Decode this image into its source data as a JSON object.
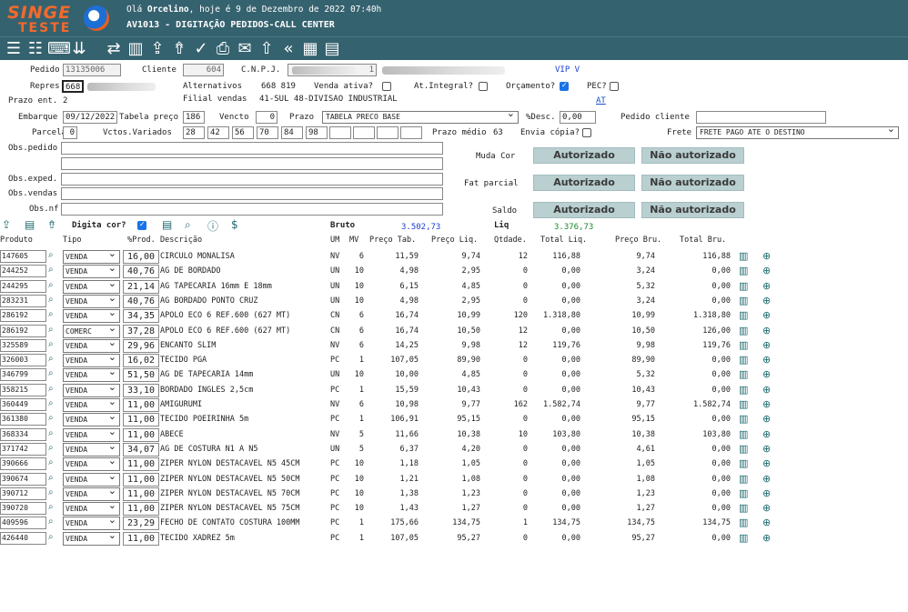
{
  "header": {
    "logo_line1": "SINGE",
    "logo_line2": "TESTE",
    "greeting_prefix": "Olá ",
    "user": "Orcelino",
    "greeting_suffix": ", hoje é 9 de Dezembro de 2022 07:40h",
    "screen_title": "AV1013 - DIGITAÇÃO PEDIDOS-CALL CENTER"
  },
  "toolbar": {
    "icons": [
      "list-icon",
      "checklist-icon",
      "keyboard-list-icon",
      "chevrons-down-icon",
      "refresh-icon",
      "book-icon",
      "upload-tray-icon",
      "upload-person-icon",
      "check-icon",
      "printer-icon",
      "email-icon",
      "upload-icon",
      "double-chevron-left-icon",
      "calculator-icon",
      "clipboard-icon"
    ]
  },
  "form": {
    "pedido_label": "Pedido",
    "pedido_value": "13135006",
    "cliente_label": "Cliente",
    "cliente_value": "604",
    "cnpj_label": "C.N.P.J.",
    "cnpj_suffix": "1",
    "vip": "VIP V",
    "repres_label": "Repres",
    "repres_value": "668",
    "alternativos_label": "Alternativos",
    "alternativos_value": "668  819",
    "venda_ativa_label": "Venda ativa?",
    "at_integral_label": "At.Integral?",
    "orcamento_label": "Orçamento?",
    "pec_label": "PEC?",
    "prazo_ent_label": "Prazo ent.",
    "prazo_ent_value": "2",
    "filial_label": "Filial vendas",
    "filial_value": "41-SUL 48-DIVISAO INDUSTRIAL",
    "at_link": "AT",
    "embarque_label": "Embarque",
    "embarque_value": "09/12/2022",
    "tabela_preco_label": "Tabela preço",
    "tabela_preco_value": "186",
    "vencto_label": "Vencto",
    "vencto_value": "0",
    "prazo_label": "Prazo",
    "prazo_value": "TABELA PRECO BASE",
    "desc_label": "%Desc.",
    "desc_value": "0,00",
    "pedido_cliente_label": "Pedido cliente",
    "parcela_label": "Parcela",
    "parcela_value": "0",
    "vctos_label": "Vctos.Variados",
    "vctos_values": [
      "28",
      "42",
      "56",
      "70",
      "84",
      "98",
      "",
      "",
      "",
      ""
    ],
    "prazo_medio_label": "Prazo médio",
    "prazo_medio_value": "63",
    "envia_copia_label": "Envia cópia?",
    "frete_label": "Frete",
    "frete_value": "FRETE PAGO ATE O DESTINO",
    "obs_pedido_label": "Obs.pedido",
    "obs_exped_label": "Obs.exped.",
    "obs_vendas_label": "Obs.vendas",
    "obs_nf_label": "Obs.nf",
    "muda_cor_label": "Muda Cor",
    "fat_parcial_label": "Fat parcial",
    "saldo_label": "Saldo",
    "autorizado_label": "Autorizado",
    "nao_autorizado_label": "Não autorizado",
    "digita_cor_label": "Digita cor?",
    "bruto_label": "Bruto",
    "bruto_value": "3.502,73",
    "liq_label": "Liq",
    "liq_value": "3.376,73",
    "bruto_color": "#1a3fd0",
    "liq_color": "#1a8a2a"
  },
  "grid": {
    "headers": {
      "produto": "Produto",
      "tipo": "Tipo",
      "pct_prod": "%Prod.",
      "descricao": "Descrição",
      "um": "UM",
      "mv": "MV",
      "preco_tab": "Preço Tab.",
      "preco_liq": "Preço Liq.",
      "qtdade": "Qtdade.",
      "total_liq": "Total Liq.",
      "preco_bru": "Preço Bru.",
      "total_bru": "Total Bru."
    },
    "rows": [
      {
        "codigo": "147605",
        "tipo": "VENDA",
        "pct": "16,00",
        "descricao": "CIRCULO MONALISA",
        "um": "NV",
        "mv": "6",
        "preco_tab": "11,59",
        "preco_liq": "9,74",
        "qtd": "12",
        "total_liq": "116,88",
        "preco_bru": "9,74",
        "total_bru": "116,88"
      },
      {
        "codigo": "244252",
        "tipo": "VENDA",
        "pct": "40,76",
        "descricao": "AG DE BORDADO",
        "um": "UN",
        "mv": "10",
        "preco_tab": "4,98",
        "preco_liq": "2,95",
        "qtd": "0",
        "total_liq": "0,00",
        "preco_bru": "3,24",
        "total_bru": "0,00"
      },
      {
        "codigo": "244295",
        "tipo": "VENDA",
        "pct": "21,14",
        "descricao": "AG TAPECARIA 16mm E 18mm",
        "um": "UN",
        "mv": "10",
        "preco_tab": "6,15",
        "preco_liq": "4,85",
        "qtd": "0",
        "total_liq": "0,00",
        "preco_bru": "5,32",
        "total_bru": "0,00"
      },
      {
        "codigo": "283231",
        "tipo": "VENDA",
        "pct": "40,76",
        "descricao": "AG BORDADO PONTO CRUZ",
        "um": "UN",
        "mv": "10",
        "preco_tab": "4,98",
        "preco_liq": "2,95",
        "qtd": "0",
        "total_liq": "0,00",
        "preco_bru": "3,24",
        "total_bru": "0,00"
      },
      {
        "codigo": "286192",
        "tipo": "VENDA",
        "pct": "34,35",
        "descricao": "APOLO ECO 6  REF.600 (627 MT)",
        "um": "CN",
        "mv": "6",
        "preco_tab": "16,74",
        "preco_liq": "10,99",
        "qtd": "120",
        "total_liq": "1.318,80",
        "preco_bru": "10,99",
        "total_bru": "1.318,80"
      },
      {
        "codigo": "286192",
        "tipo": "COMERC",
        "pct": "37,28",
        "descricao": "APOLO ECO 6  REF.600 (627 MT)",
        "um": "CN",
        "mv": "6",
        "preco_tab": "16,74",
        "preco_liq": "10,50",
        "qtd": "12",
        "total_liq": "0,00",
        "preco_bru": "10,50",
        "total_bru": "126,00"
      },
      {
        "codigo": "325589",
        "tipo": "VENDA",
        "pct": "29,96",
        "descricao": "ENCANTO SLIM",
        "um": "NV",
        "mv": "6",
        "preco_tab": "14,25",
        "preco_liq": "9,98",
        "qtd": "12",
        "total_liq": "119,76",
        "preco_bru": "9,98",
        "total_bru": "119,76"
      },
      {
        "codigo": "326003",
        "tipo": "VENDA",
        "pct": "16,02",
        "descricao": "TECIDO PGA",
        "um": "PC",
        "mv": "1",
        "preco_tab": "107,05",
        "preco_liq": "89,90",
        "qtd": "0",
        "total_liq": "0,00",
        "preco_bru": "89,90",
        "total_bru": "0,00"
      },
      {
        "codigo": "346799",
        "tipo": "VENDA",
        "pct": "51,50",
        "descricao": "AG DE TAPECARIA 14mm",
        "um": "UN",
        "mv": "10",
        "preco_tab": "10,00",
        "preco_liq": "4,85",
        "qtd": "0",
        "total_liq": "0,00",
        "preco_bru": "5,32",
        "total_bru": "0,00"
      },
      {
        "codigo": "358215",
        "tipo": "VENDA",
        "pct": "33,10",
        "descricao": "BORDADO INGLES 2,5cm",
        "um": "PC",
        "mv": "1",
        "preco_tab": "15,59",
        "preco_liq": "10,43",
        "qtd": "0",
        "total_liq": "0,00",
        "preco_bru": "10,43",
        "total_bru": "0,00"
      },
      {
        "codigo": "360449",
        "tipo": "VENDA",
        "pct": "11,00",
        "descricao": "AMIGURUMI",
        "um": "NV",
        "mv": "6",
        "preco_tab": "10,98",
        "preco_liq": "9,77",
        "qtd": "162",
        "total_liq": "1.582,74",
        "preco_bru": "9,77",
        "total_bru": "1.582,74"
      },
      {
        "codigo": "361380",
        "tipo": "VENDA",
        "pct": "11,00",
        "descricao": "TECIDO POEIRINHA 5m",
        "um": "PC",
        "mv": "1",
        "preco_tab": "106,91",
        "preco_liq": "95,15",
        "qtd": "0",
        "total_liq": "0,00",
        "preco_bru": "95,15",
        "total_bru": "0,00"
      },
      {
        "codigo": "368334",
        "tipo": "VENDA",
        "pct": "11,00",
        "descricao": "ABECE",
        "um": "NV",
        "mv": "5",
        "preco_tab": "11,66",
        "preco_liq": "10,38",
        "qtd": "10",
        "total_liq": "103,80",
        "preco_bru": "10,38",
        "total_bru": "103,80"
      },
      {
        "codigo": "371742",
        "tipo": "VENDA",
        "pct": "34,07",
        "descricao": "AG DE COSTURA N1 A N5",
        "um": "UN",
        "mv": "5",
        "preco_tab": "6,37",
        "preco_liq": "4,20",
        "qtd": "0",
        "total_liq": "0,00",
        "preco_bru": "4,61",
        "total_bru": "0,00"
      },
      {
        "codigo": "390666",
        "tipo": "VENDA",
        "pct": "11,00",
        "descricao": "ZIPER NYLON DESTACAVEL N5 45CM",
        "um": "PC",
        "mv": "10",
        "preco_tab": "1,18",
        "preco_liq": "1,05",
        "qtd": "0",
        "total_liq": "0,00",
        "preco_bru": "1,05",
        "total_bru": "0,00"
      },
      {
        "codigo": "390674",
        "tipo": "VENDA",
        "pct": "11,00",
        "descricao": "ZIPER NYLON DESTACAVEL N5 50CM",
        "um": "PC",
        "mv": "10",
        "preco_tab": "1,21",
        "preco_liq": "1,08",
        "qtd": "0",
        "total_liq": "0,00",
        "preco_bru": "1,08",
        "total_bru": "0,00"
      },
      {
        "codigo": "390712",
        "tipo": "VENDA",
        "pct": "11,00",
        "descricao": "ZIPER NYLON DESTACAVEL N5 70CM",
        "um": "PC",
        "mv": "10",
        "preco_tab": "1,38",
        "preco_liq": "1,23",
        "qtd": "0",
        "total_liq": "0,00",
        "preco_bru": "1,23",
        "total_bru": "0,00"
      },
      {
        "codigo": "390720",
        "tipo": "VENDA",
        "pct": "11,00",
        "descricao": "ZIPER NYLON DESTACAVEL N5 75CM",
        "um": "PC",
        "mv": "10",
        "preco_tab": "1,43",
        "preco_liq": "1,27",
        "qtd": "0",
        "total_liq": "0,00",
        "preco_bru": "1,27",
        "total_bru": "0,00"
      },
      {
        "codigo": "409596",
        "tipo": "VENDA",
        "pct": "23,29",
        "descricao": "FECHO DE CONTATO COSTURA 100MM",
        "um": "PC",
        "mv": "1",
        "preco_tab": "175,66",
        "preco_liq": "134,75",
        "qtd": "1",
        "total_liq": "134,75",
        "preco_bru": "134,75",
        "total_bru": "134,75"
      },
      {
        "codigo": "426440",
        "tipo": "VENDA",
        "pct": "11,00",
        "descricao": "TECIDO XADREZ 5m",
        "um": "PC",
        "mv": "1",
        "preco_tab": "107,05",
        "preco_liq": "95,27",
        "qtd": "0",
        "total_liq": "0,00",
        "preco_bru": "95,27",
        "total_bru": "0,00"
      }
    ]
  }
}
